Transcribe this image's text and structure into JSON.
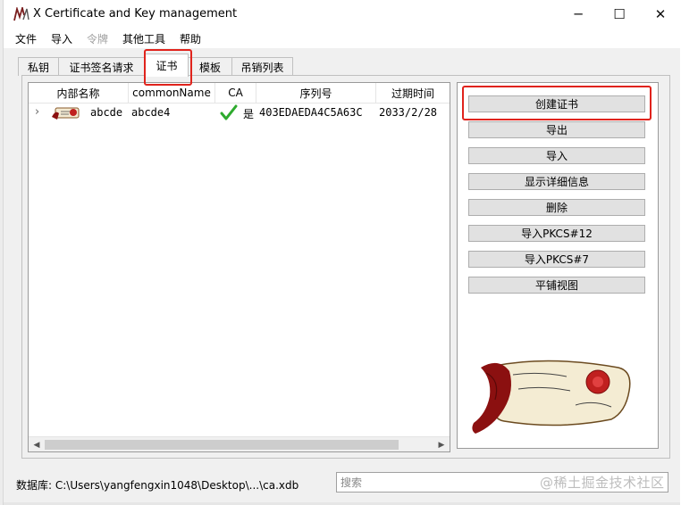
{
  "window": {
    "title": "X Certificate and Key management",
    "controls": {
      "minimize": "─",
      "maximize": "☐",
      "close": "✕"
    }
  },
  "menu": [
    "文件",
    "导入",
    "令牌",
    "其他工具",
    "帮助"
  ],
  "menu_disabled_index": 2,
  "tabs": [
    "私钥",
    "证书签名请求",
    "证书",
    "模板",
    "吊销列表"
  ],
  "active_tab": "证书",
  "cert_list": {
    "columns": [
      "内部名称",
      "commonName",
      "CA",
      "序列号",
      "过期时间"
    ],
    "rows": [
      {
        "internal_name": "abcde",
        "common_name": "abcde4",
        "ca": "是",
        "serial": "403EDAEDA4C5A63C",
        "expiry": "2033/2/28"
      }
    ]
  },
  "buttons": [
    "创建证书",
    "导出",
    "导入",
    "显示详细信息",
    "删除",
    "导入PKCS#12",
    "导入PKCS#7",
    "平铺视图"
  ],
  "status": {
    "database": "数据库: C:\\Users\\yangfengxin1048\\Desktop\\...\\ca.xdb",
    "search_placeholder": "搜索"
  },
  "watermark": "@稀土掘金技术社区",
  "colors": {
    "highlight": "#e0231c",
    "check": "#2eaa2e",
    "window_bg": "#f0f0f0",
    "button_bg": "#e1e1e1"
  },
  "icons": [
    "xca-logo-icon",
    "certificate-icon",
    "check-icon",
    "chevron-right-icon"
  ]
}
